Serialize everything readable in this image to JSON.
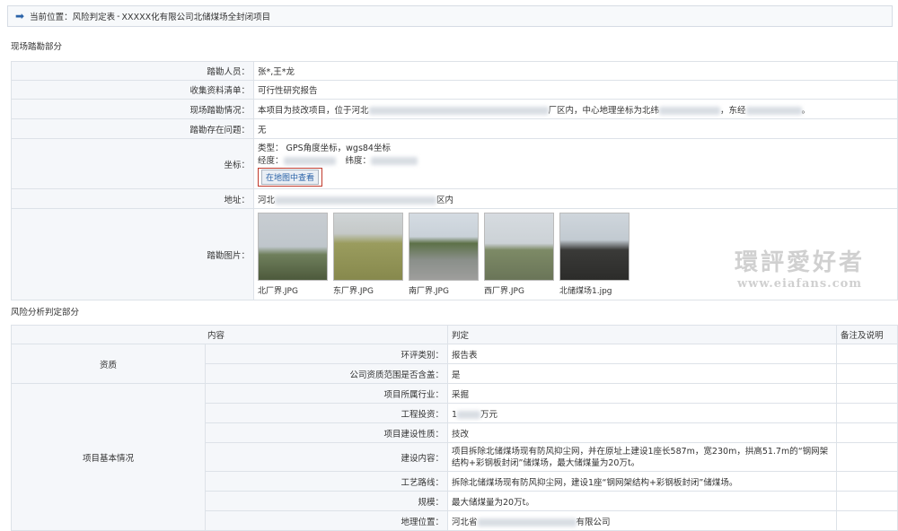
{
  "breadcrumb": {
    "prefix": "当前位置",
    "colon": "：",
    "page": "风险判定表",
    "separator": "-",
    "project": "XXXXX化有限公司北储煤场全封闭项目"
  },
  "site": {
    "title": "现场踏勘部分",
    "rows": {
      "surveyors": {
        "label": "踏勘人员：",
        "value": "张*,王*龙"
      },
      "materials": {
        "label": "收集资料清单：",
        "value": "可行性研究报告"
      },
      "situation": {
        "label": "现场踏勘情况：",
        "v1": "本项目为技改项目，位于河北",
        "v2": "厂区内，中心地理坐标为北纬",
        "v3": "，东经",
        "v4": "。"
      },
      "problems": {
        "label": "踏勘存在问题：",
        "value": "无"
      },
      "coords": {
        "label": "坐标：",
        "type": "类型： GPS角度坐标，wgs84坐标",
        "lng": "经度：",
        "lat": "纬度：",
        "map_button": "在地图中查看"
      },
      "address": {
        "label": "地址：",
        "v1": "河北",
        "v2": "区内"
      },
      "photos": {
        "label": "踏勘图片：",
        "items": [
          "北厂界.JPG",
          "东厂界.JPG",
          "南厂界.JPG",
          "西厂界.JPG",
          "北储煤场1.jpg"
        ]
      }
    }
  },
  "risk": {
    "title": "风险分析判定部分",
    "headers": {
      "content": "内容",
      "judgment": "判定",
      "note": "备注及说明"
    },
    "groups": {
      "qualification": "资质",
      "basic": "项目基本情况"
    },
    "rows": {
      "eia_type": {
        "label": "环评类别：",
        "value": "报告表"
      },
      "scope": {
        "label": "公司资质范围是否含盖：",
        "value": "是"
      },
      "industry": {
        "label": "项目所属行业：",
        "value": "采掘"
      },
      "investment": {
        "label": "工程投资：",
        "v1": "1",
        "v2": "万元"
      },
      "nature": {
        "label": "项目建设性质：",
        "value": "技改"
      },
      "content": {
        "label": "建设内容：",
        "value": "项目拆除北储煤场现有防风抑尘网，并在原址上建设1座长587m，宽230m，拱高51.7m的“钢网架结构+彩钢板封闭”储煤场，最大储煤量为20万t。"
      },
      "process": {
        "label": "工艺路线：",
        "value": "拆除北储煤场现有防风抑尘网，建设1座“钢网架结构+彩钢板封闭”储煤场。"
      },
      "scale": {
        "label": "规模：",
        "value": "最大储煤量为20万t。"
      },
      "location": {
        "label": "地理位置：",
        "v1": "河北省",
        "v2": "有限公司"
      }
    }
  },
  "watermark": {
    "cn": "環評愛好者",
    "url": "www.eiafans.com"
  }
}
